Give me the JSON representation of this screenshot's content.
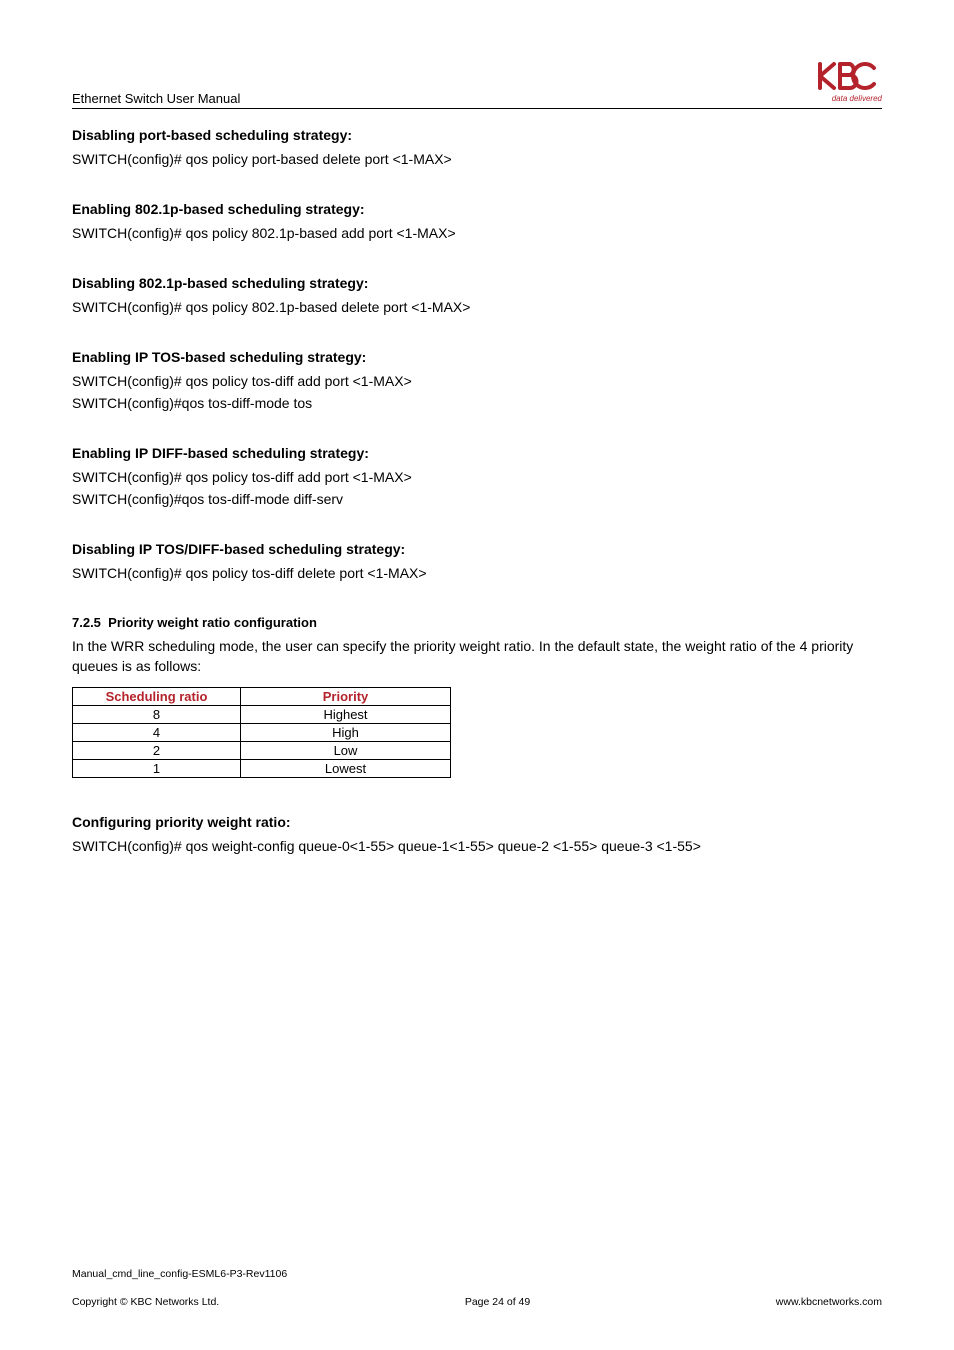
{
  "header": {
    "manual_title": "Ethernet Switch User Manual",
    "logo_tagline": "data delivered"
  },
  "sections": {
    "disable_port": {
      "heading": "Disabling port-based scheduling strategy:",
      "cmd": "SWITCH(config)# qos policy port-based delete port <1-MAX>"
    },
    "enable_8021p": {
      "heading": "Enabling 802.1p-based scheduling strategy:",
      "cmd": "SWITCH(config)# qos policy 802.1p-based add port <1-MAX>"
    },
    "disable_8021p": {
      "heading": "Disabling 802.1p-based scheduling strategy:",
      "cmd": "SWITCH(config)# qos policy 802.1p-based delete port <1-MAX>"
    },
    "enable_tos": {
      "heading": "Enabling IP TOS-based scheduling strategy:",
      "cmd1": "SWITCH(config)# qos policy tos-diff add port <1-MAX>",
      "cmd2": "SWITCH(config)#qos tos-diff-mode tos"
    },
    "enable_diff": {
      "heading": "Enabling IP DIFF-based scheduling strategy:",
      "cmd1": "SWITCH(config)# qos policy tos-diff add port <1-MAX>",
      "cmd2": "SWITCH(config)#qos tos-diff-mode diff-serv"
    },
    "disable_tosdiff": {
      "heading": "Disabling IP TOS/DIFF-based scheduling strategy:",
      "cmd": "SWITCH(config)# qos policy tos-diff delete port <1-MAX>"
    },
    "priority_weight": {
      "number": "7.2.5",
      "title": "Priority weight ratio configuration",
      "para": "In the WRR scheduling mode, the user can specify the priority weight ratio. In the default state, the weight ratio of the 4 priority queues is as follows:",
      "table": {
        "head": {
          "c1": "Scheduling ratio",
          "c2": "Priority"
        },
        "rows": [
          {
            "c1": "8",
            "c2": "Highest"
          },
          {
            "c1": "4",
            "c2": "High"
          },
          {
            "c1": "2",
            "c2": "Low"
          },
          {
            "c1": "1",
            "c2": "Lowest"
          }
        ]
      }
    },
    "config_weight": {
      "heading": "Configuring priority weight ratio:",
      "cmd": "SWITCH(config)# qos weight-config queue-0<1-55> queue-1<1-55> queue-2 <1-55> queue-3 <1-55>"
    }
  },
  "footer": {
    "doc_id": "Manual_cmd_line_config-ESML6-P3-Rev1106",
    "copyright": "Copyright © KBC Networks Ltd.",
    "page": "Page 24 of 49",
    "url": "www.kbcnetworks.com"
  }
}
